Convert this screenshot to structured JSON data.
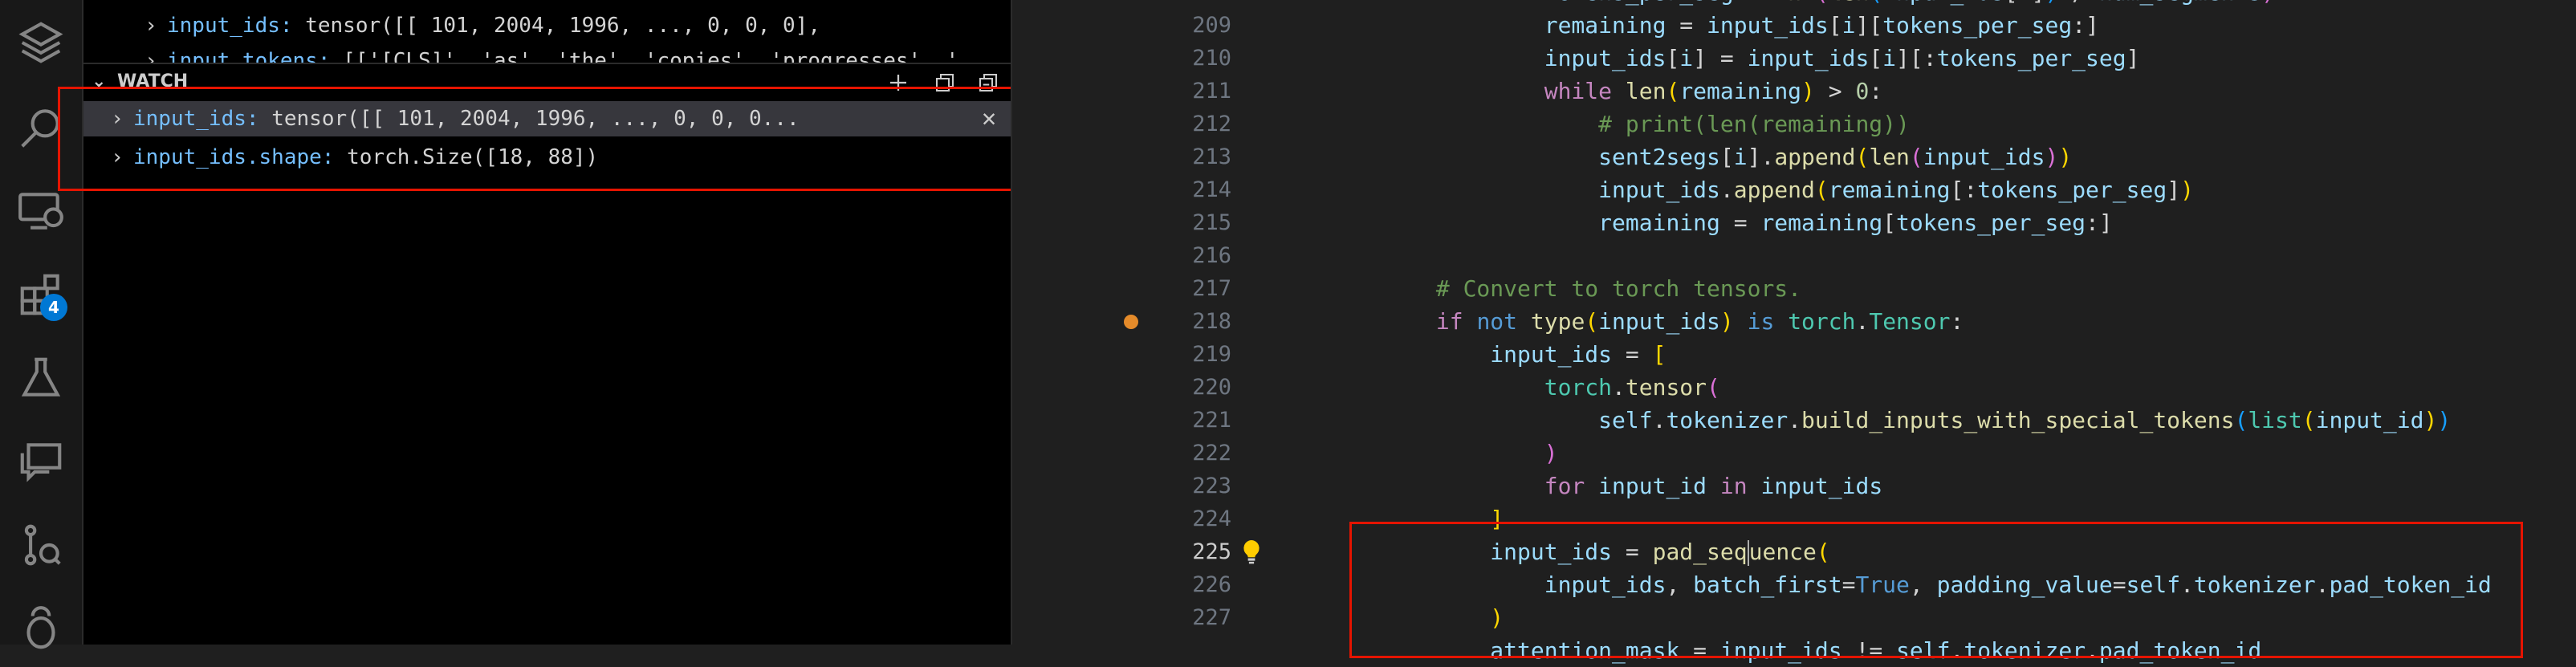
{
  "colors": {
    "accent": "#0078d4",
    "highlight_box": "#e51400",
    "breakpoint": "#e58b2a"
  },
  "activity_bar": {
    "icons": [
      "explorer-icon",
      "search-icon",
      "remote-explorer-icon",
      "extensions-icon",
      "testing-icon",
      "comments-icon",
      "source-control-icon",
      "debug-icon"
    ],
    "extensions_badge": "4"
  },
  "sidebar": {
    "variables_top_row": {
      "key": "input_ids:",
      "value": "tensor([[  101,  2004,  1996,  ...,     0,     0,     0],"
    },
    "variables_partial_row": {
      "key": "input_tokens:",
      "value": "[['[CLS]', 'as', 'the', 'copies', 'progresses', '..."
    },
    "watch": {
      "title": "WATCH",
      "items": [
        {
          "key": "input_ids:",
          "value": "tensor([[  101,  2004,  1996,  ...,     0,     0,     0..."
        },
        {
          "key": "input_ids.shape:",
          "value": "torch.Size([18, 88])"
        }
      ]
    }
  },
  "editor": {
    "line_numbers": [
      "209",
      "210",
      "211",
      "212",
      "213",
      "214",
      "215",
      "216",
      "217",
      "218",
      "219",
      "220",
      "221",
      "222",
      "223",
      "224",
      "225",
      "226",
      "227"
    ],
    "active_line": "225",
    "breakpoint_line": "218"
  }
}
